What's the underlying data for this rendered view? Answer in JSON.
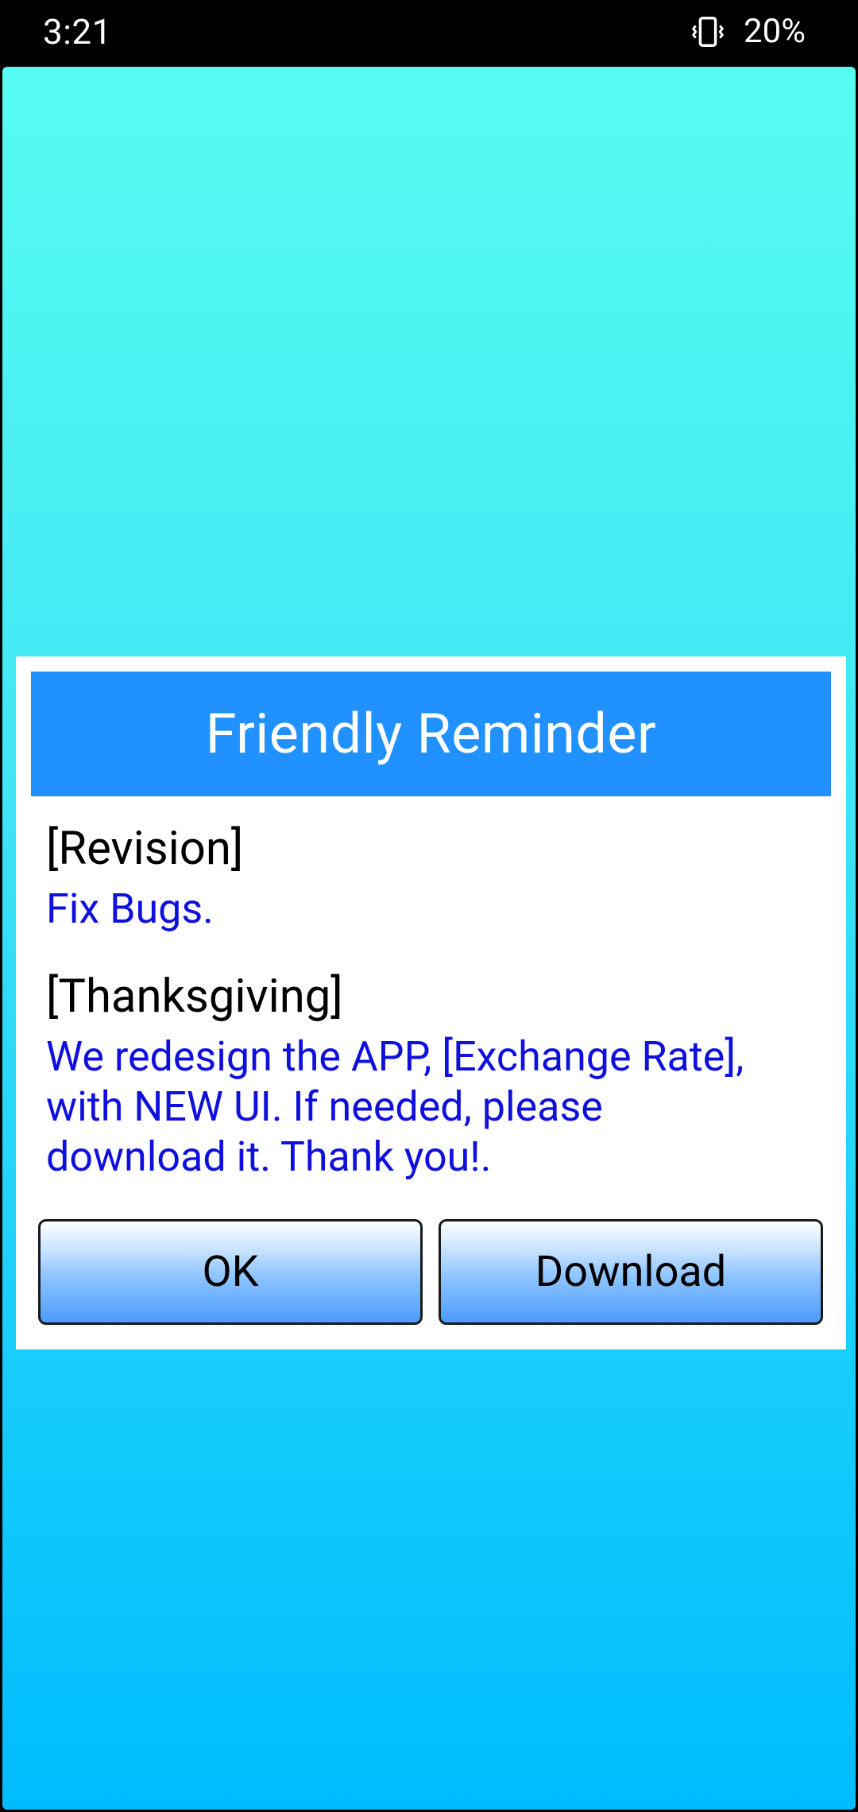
{
  "status_bar": {
    "time": "3:21",
    "vibrate_icon": "vibrate-icon",
    "battery": "20%"
  },
  "colors": {
    "background_top": "#57fcf0",
    "background_bottom": "#00bcff",
    "header": "#2191ff",
    "body_text": "#1010dd"
  },
  "dialog": {
    "title": "Friendly Reminder",
    "sections": [
      {
        "heading": "[Revision]",
        "text": "Fix Bugs."
      },
      {
        "heading": "[Thanksgiving]",
        "text": "We redesign the APP, [Exchange Rate], with NEW UI. If needed, please download it. Thank you!."
      }
    ],
    "buttons": {
      "ok": "OK",
      "download": "Download"
    }
  }
}
